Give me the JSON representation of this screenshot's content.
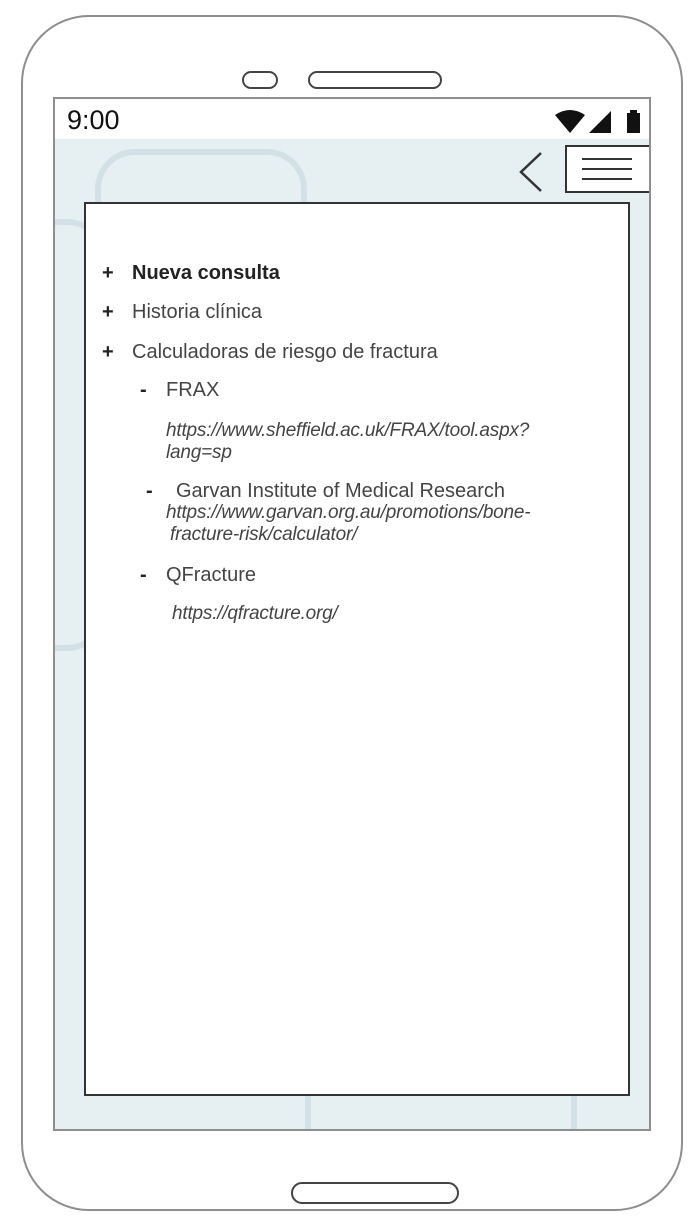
{
  "status_bar": {
    "time": "9:00",
    "icons": [
      "wifi-icon",
      "signal-icon",
      "battery-icon"
    ]
  },
  "header": {
    "back_icon": "chevron-left-icon",
    "menu_icon": "hamburger-menu-icon"
  },
  "menu": {
    "items": [
      {
        "bullet": "+",
        "label": "Nueva consulta",
        "bold": true
      },
      {
        "bullet": "+",
        "label": "Historia clínica",
        "bold": false
      },
      {
        "bullet": "+",
        "label": "Calculadoras de riesgo de fractura",
        "bold": false
      }
    ],
    "calculators": [
      {
        "dash": "-",
        "name": "FRAX",
        "url_line1": "https://www.sheffield.ac.uk/FRAX/tool.aspx?",
        "url_line2": "lang=sp"
      },
      {
        "dash": "-",
        "name": "Garvan Institute of Medical Research",
        "url_line1": "https://www.garvan.org.au/promotions/bone-",
        "url_line2": "fracture-risk/calculator/"
      },
      {
        "dash": "-",
        "name": "QFracture",
        "url_line1": "https://qfracture.org/"
      }
    ]
  },
  "colors": {
    "screen_background": "#e6f0f3",
    "frame": "#8e8e8e",
    "text": "#444444"
  }
}
